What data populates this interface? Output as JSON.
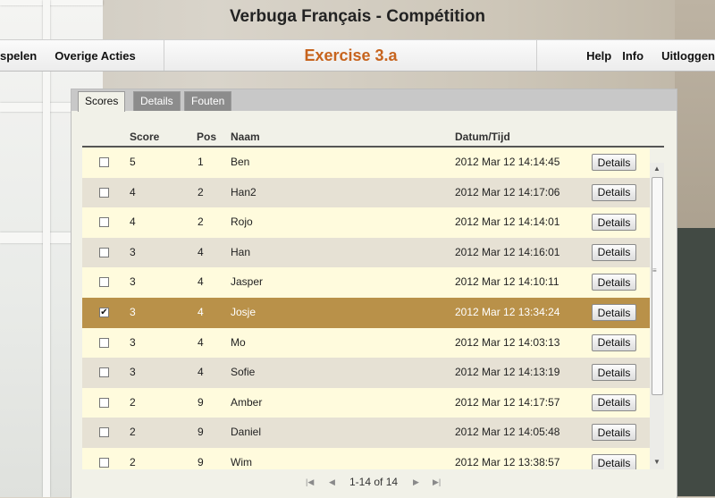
{
  "app": {
    "title": "Verbuga Français - Compétition"
  },
  "menubar": {
    "left_items": [
      "spelen",
      "Overige Acties"
    ],
    "exercise_title": "Exercise 3.a",
    "right_items": [
      "Help",
      "Info",
      "Uitloggen"
    ]
  },
  "tabs": [
    {
      "label": "Scores",
      "active": true
    },
    {
      "label": "Details",
      "active": false
    },
    {
      "label": "Fouten",
      "active": false
    }
  ],
  "table": {
    "headers": {
      "score": "Score",
      "pos": "Pos",
      "naam": "Naam",
      "datum": "Datum/Tijd"
    },
    "button_label": "Details",
    "rows": [
      {
        "score": "5",
        "pos": "1",
        "naam": "Ben",
        "datum": "2012 Mar 12 14:14:45",
        "checked": false,
        "selected": false
      },
      {
        "score": "4",
        "pos": "2",
        "naam": "Han2",
        "datum": "2012 Mar 12 14:17:06",
        "checked": false,
        "selected": false
      },
      {
        "score": "4",
        "pos": "2",
        "naam": "Rojo",
        "datum": "2012 Mar 12 14:14:01",
        "checked": false,
        "selected": false
      },
      {
        "score": "3",
        "pos": "4",
        "naam": "Han",
        "datum": "2012 Mar 12 14:16:01",
        "checked": false,
        "selected": false
      },
      {
        "score": "3",
        "pos": "4",
        "naam": "Jasper",
        "datum": "2012 Mar 12 14:10:11",
        "checked": false,
        "selected": false
      },
      {
        "score": "3",
        "pos": "4",
        "naam": "Josje",
        "datum": "2012 Mar 12 13:34:24",
        "checked": true,
        "selected": true
      },
      {
        "score": "3",
        "pos": "4",
        "naam": "Mo",
        "datum": "2012 Mar 12 14:03:13",
        "checked": false,
        "selected": false
      },
      {
        "score": "3",
        "pos": "4",
        "naam": "Sofie",
        "datum": "2012 Mar 12 14:13:19",
        "checked": false,
        "selected": false
      },
      {
        "score": "2",
        "pos": "9",
        "naam": "Amber",
        "datum": "2012 Mar 12 14:17:57",
        "checked": false,
        "selected": false
      },
      {
        "score": "2",
        "pos": "9",
        "naam": "Daniel",
        "datum": "2012 Mar 12 14:05:48",
        "checked": false,
        "selected": false
      },
      {
        "score": "2",
        "pos": "9",
        "naam": "Wim",
        "datum": "2012 Mar 12 13:38:57",
        "checked": false,
        "selected": false
      }
    ]
  },
  "pager": {
    "text": "1-14 of 14"
  },
  "colors": {
    "accent": "#c7641e",
    "selected_row": "#b99149",
    "row_odd": "#fffbdd",
    "row_even": "#e6e1d4"
  }
}
